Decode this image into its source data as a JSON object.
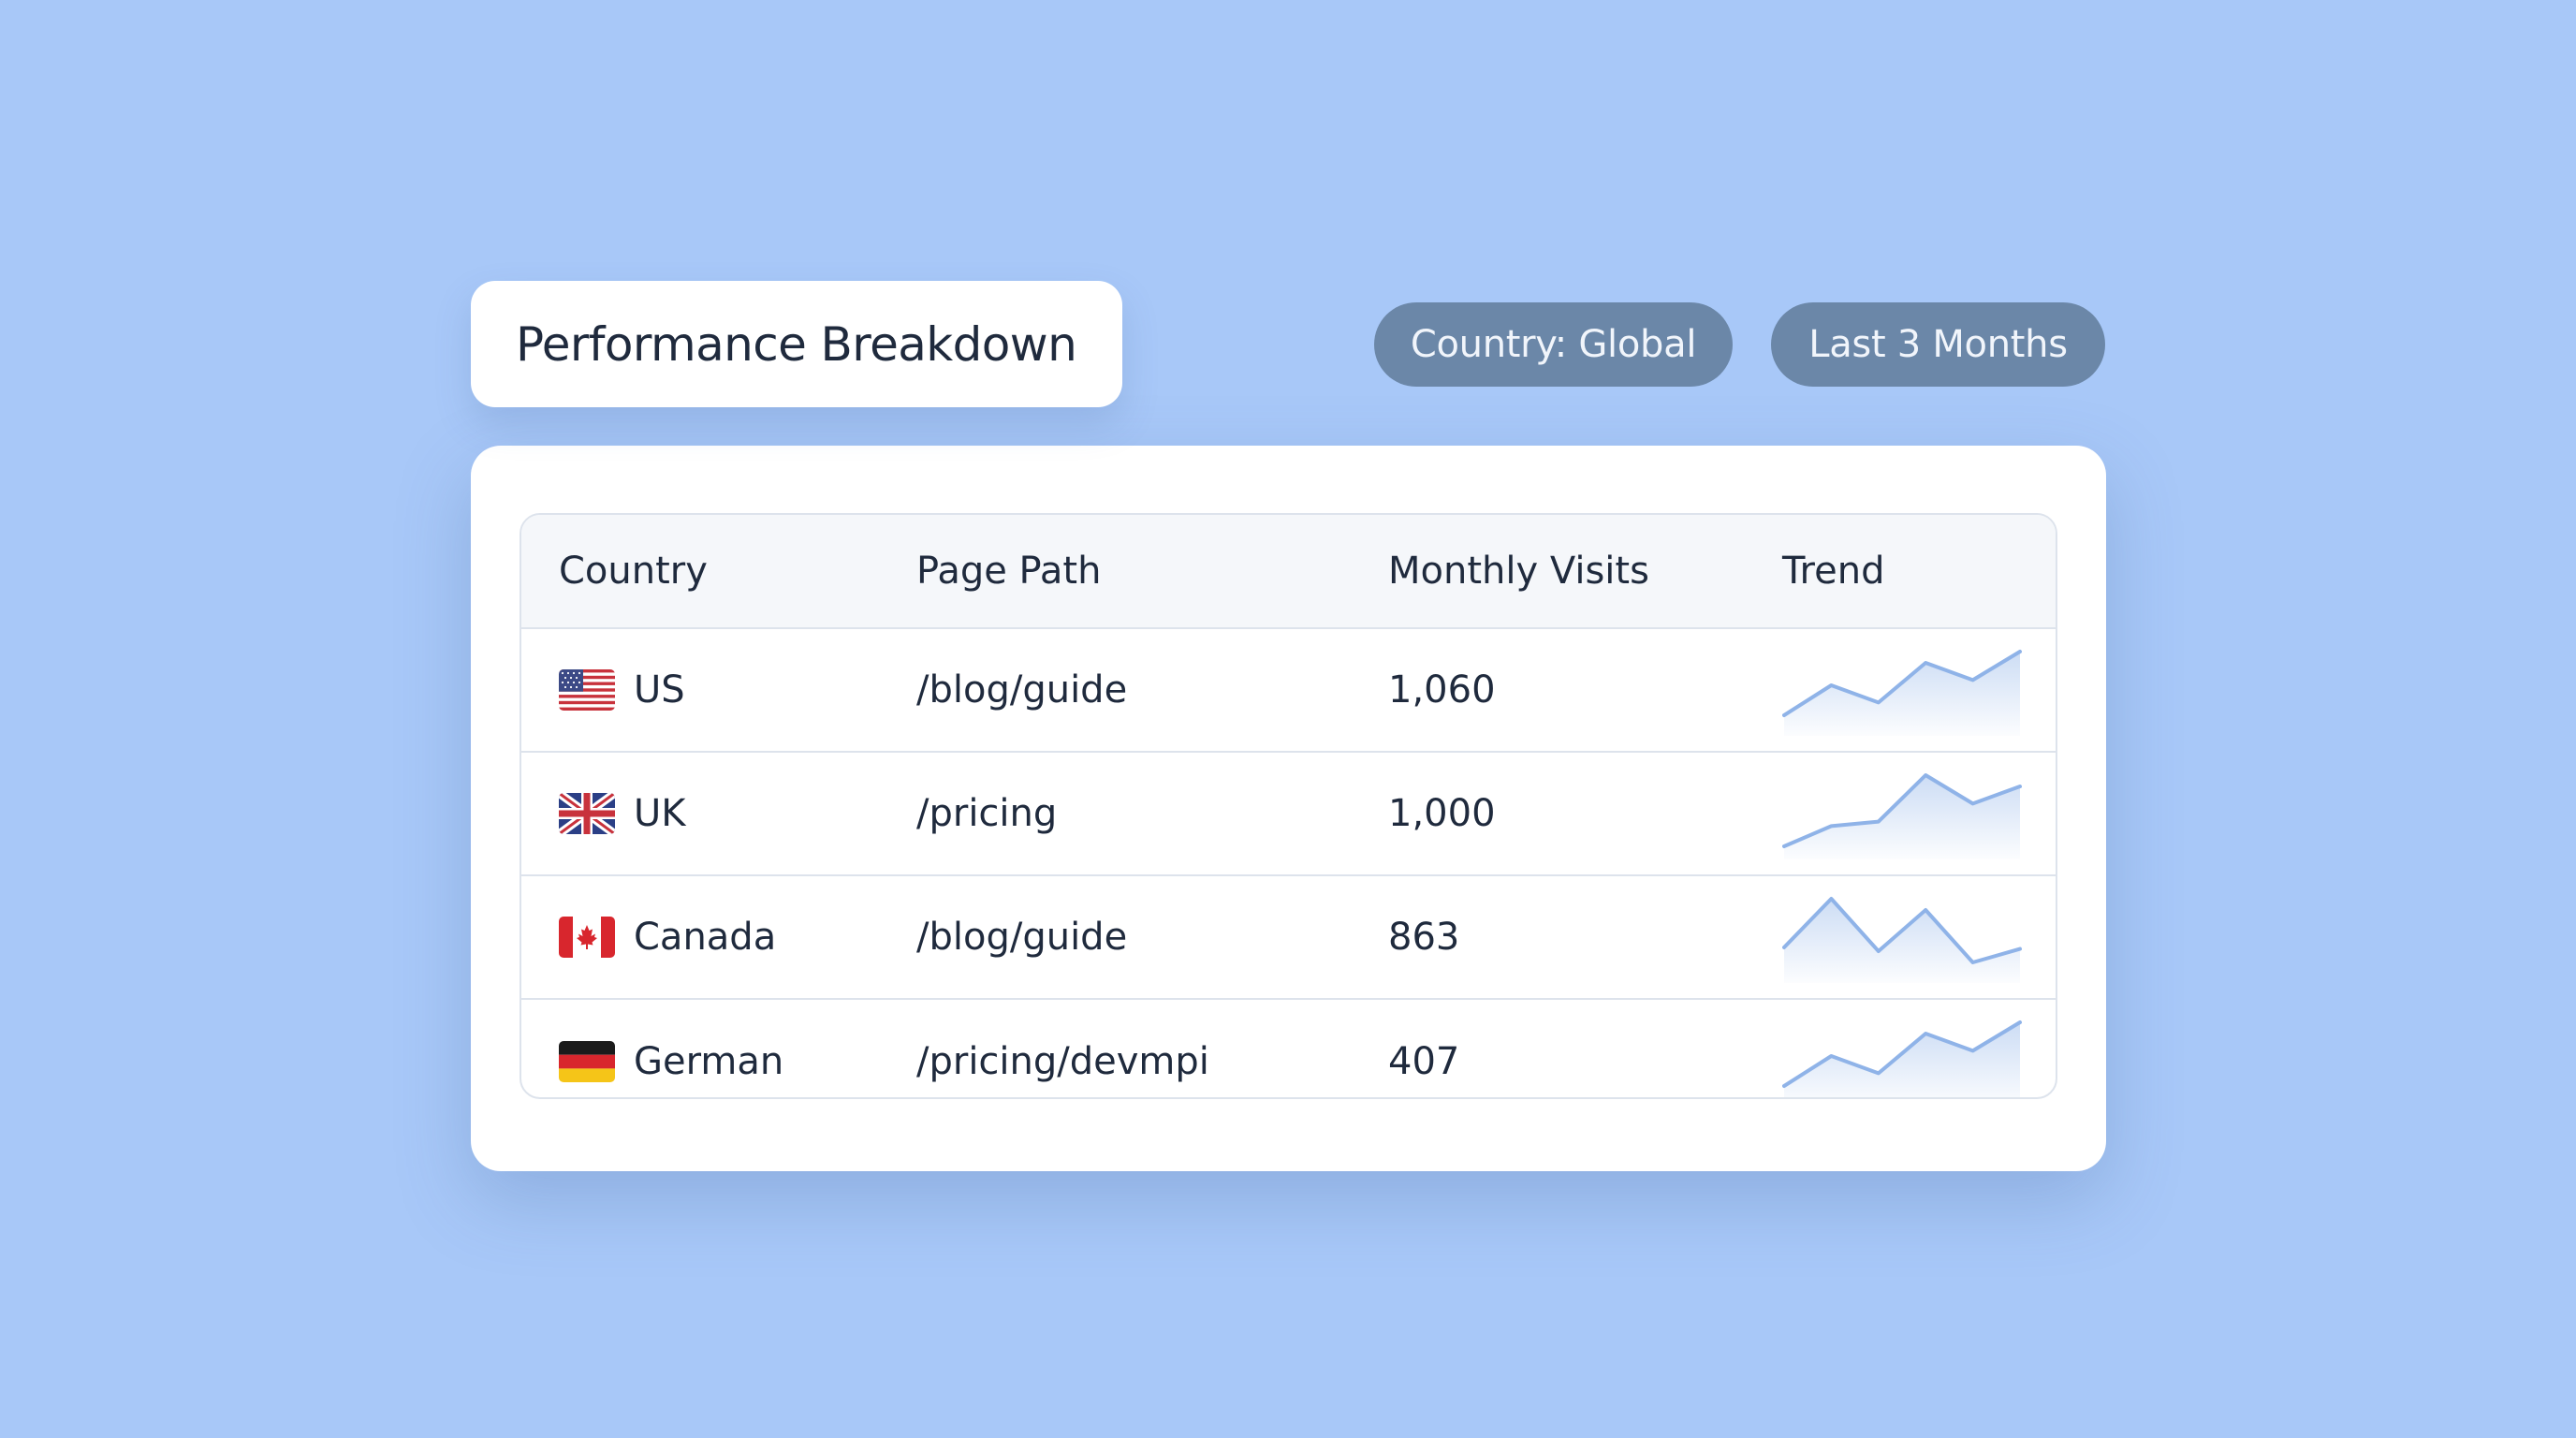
{
  "header": {
    "title": "Performance Breakdown",
    "filters": [
      {
        "label": "Country: Global"
      },
      {
        "label": "Last 3 Months"
      }
    ]
  },
  "table": {
    "columns": [
      "Country",
      "Page Path",
      "Monthly Visits",
      "Trend"
    ],
    "rows": [
      {
        "country": "US",
        "flag_icon": "us-flag-icon",
        "path": "/blog/guide",
        "visits": "1,060",
        "trend": [
          0.15,
          0.55,
          0.32,
          0.85,
          0.62,
          1.0
        ]
      },
      {
        "country": "UK",
        "flag_icon": "uk-flag-icon",
        "path": "/pricing",
        "visits": "1,000",
        "trend": [
          0.05,
          0.32,
          0.38,
          1.0,
          0.62,
          0.85
        ]
      },
      {
        "country": "Canada",
        "flag_icon": "canada-flag-icon",
        "path": "/blog/guide",
        "visits": "863",
        "trend": [
          0.35,
          1.0,
          0.3,
          0.85,
          0.15,
          0.33
        ]
      },
      {
        "country": "German",
        "flag_icon": "germany-flag-icon",
        "path": "/pricing/devmpi",
        "visits": "407",
        "trend": [
          0.15,
          0.55,
          0.32,
          0.85,
          0.62,
          1.0
        ]
      }
    ]
  },
  "colors": {
    "background": "#a8c8f8",
    "pill": "#6b87a8",
    "sparkline": "#8fb3e8"
  }
}
